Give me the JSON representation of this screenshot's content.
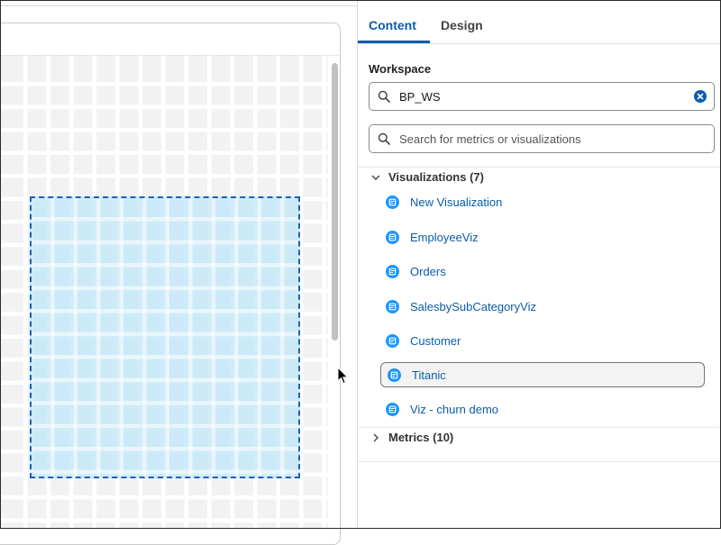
{
  "panel": {
    "tabs": [
      {
        "label": "Content",
        "active": true
      },
      {
        "label": "Design",
        "active": false
      }
    ],
    "workspace": {
      "label": "Workspace",
      "value": "BP_WS"
    },
    "search": {
      "placeholder": "Search for metrics or visualizations"
    },
    "visualizations": {
      "header": "Visualizations (7)",
      "expanded": true,
      "items": [
        {
          "label": "New Visualization"
        },
        {
          "label": "EmployeeViz"
        },
        {
          "label": "Orders"
        },
        {
          "label": "SalesbySubCategoryViz"
        },
        {
          "label": "Customer"
        },
        {
          "label": "Titanic",
          "selected": true
        },
        {
          "label": "Viz - churn demo"
        }
      ]
    },
    "metrics": {
      "header": "Metrics (10)",
      "expanded": false
    }
  },
  "icons": {
    "search": "search-icon",
    "clear": "clear-icon",
    "visualization": "visualization-icon",
    "expand": "chevron-down-icon",
    "collapse": "chevron-right-icon"
  },
  "colors": {
    "accent": "#0b5cab",
    "selection_fill": "#bee6f8",
    "selection_border": "#1f5fb8",
    "grid_cell": "#f2f2f2"
  }
}
